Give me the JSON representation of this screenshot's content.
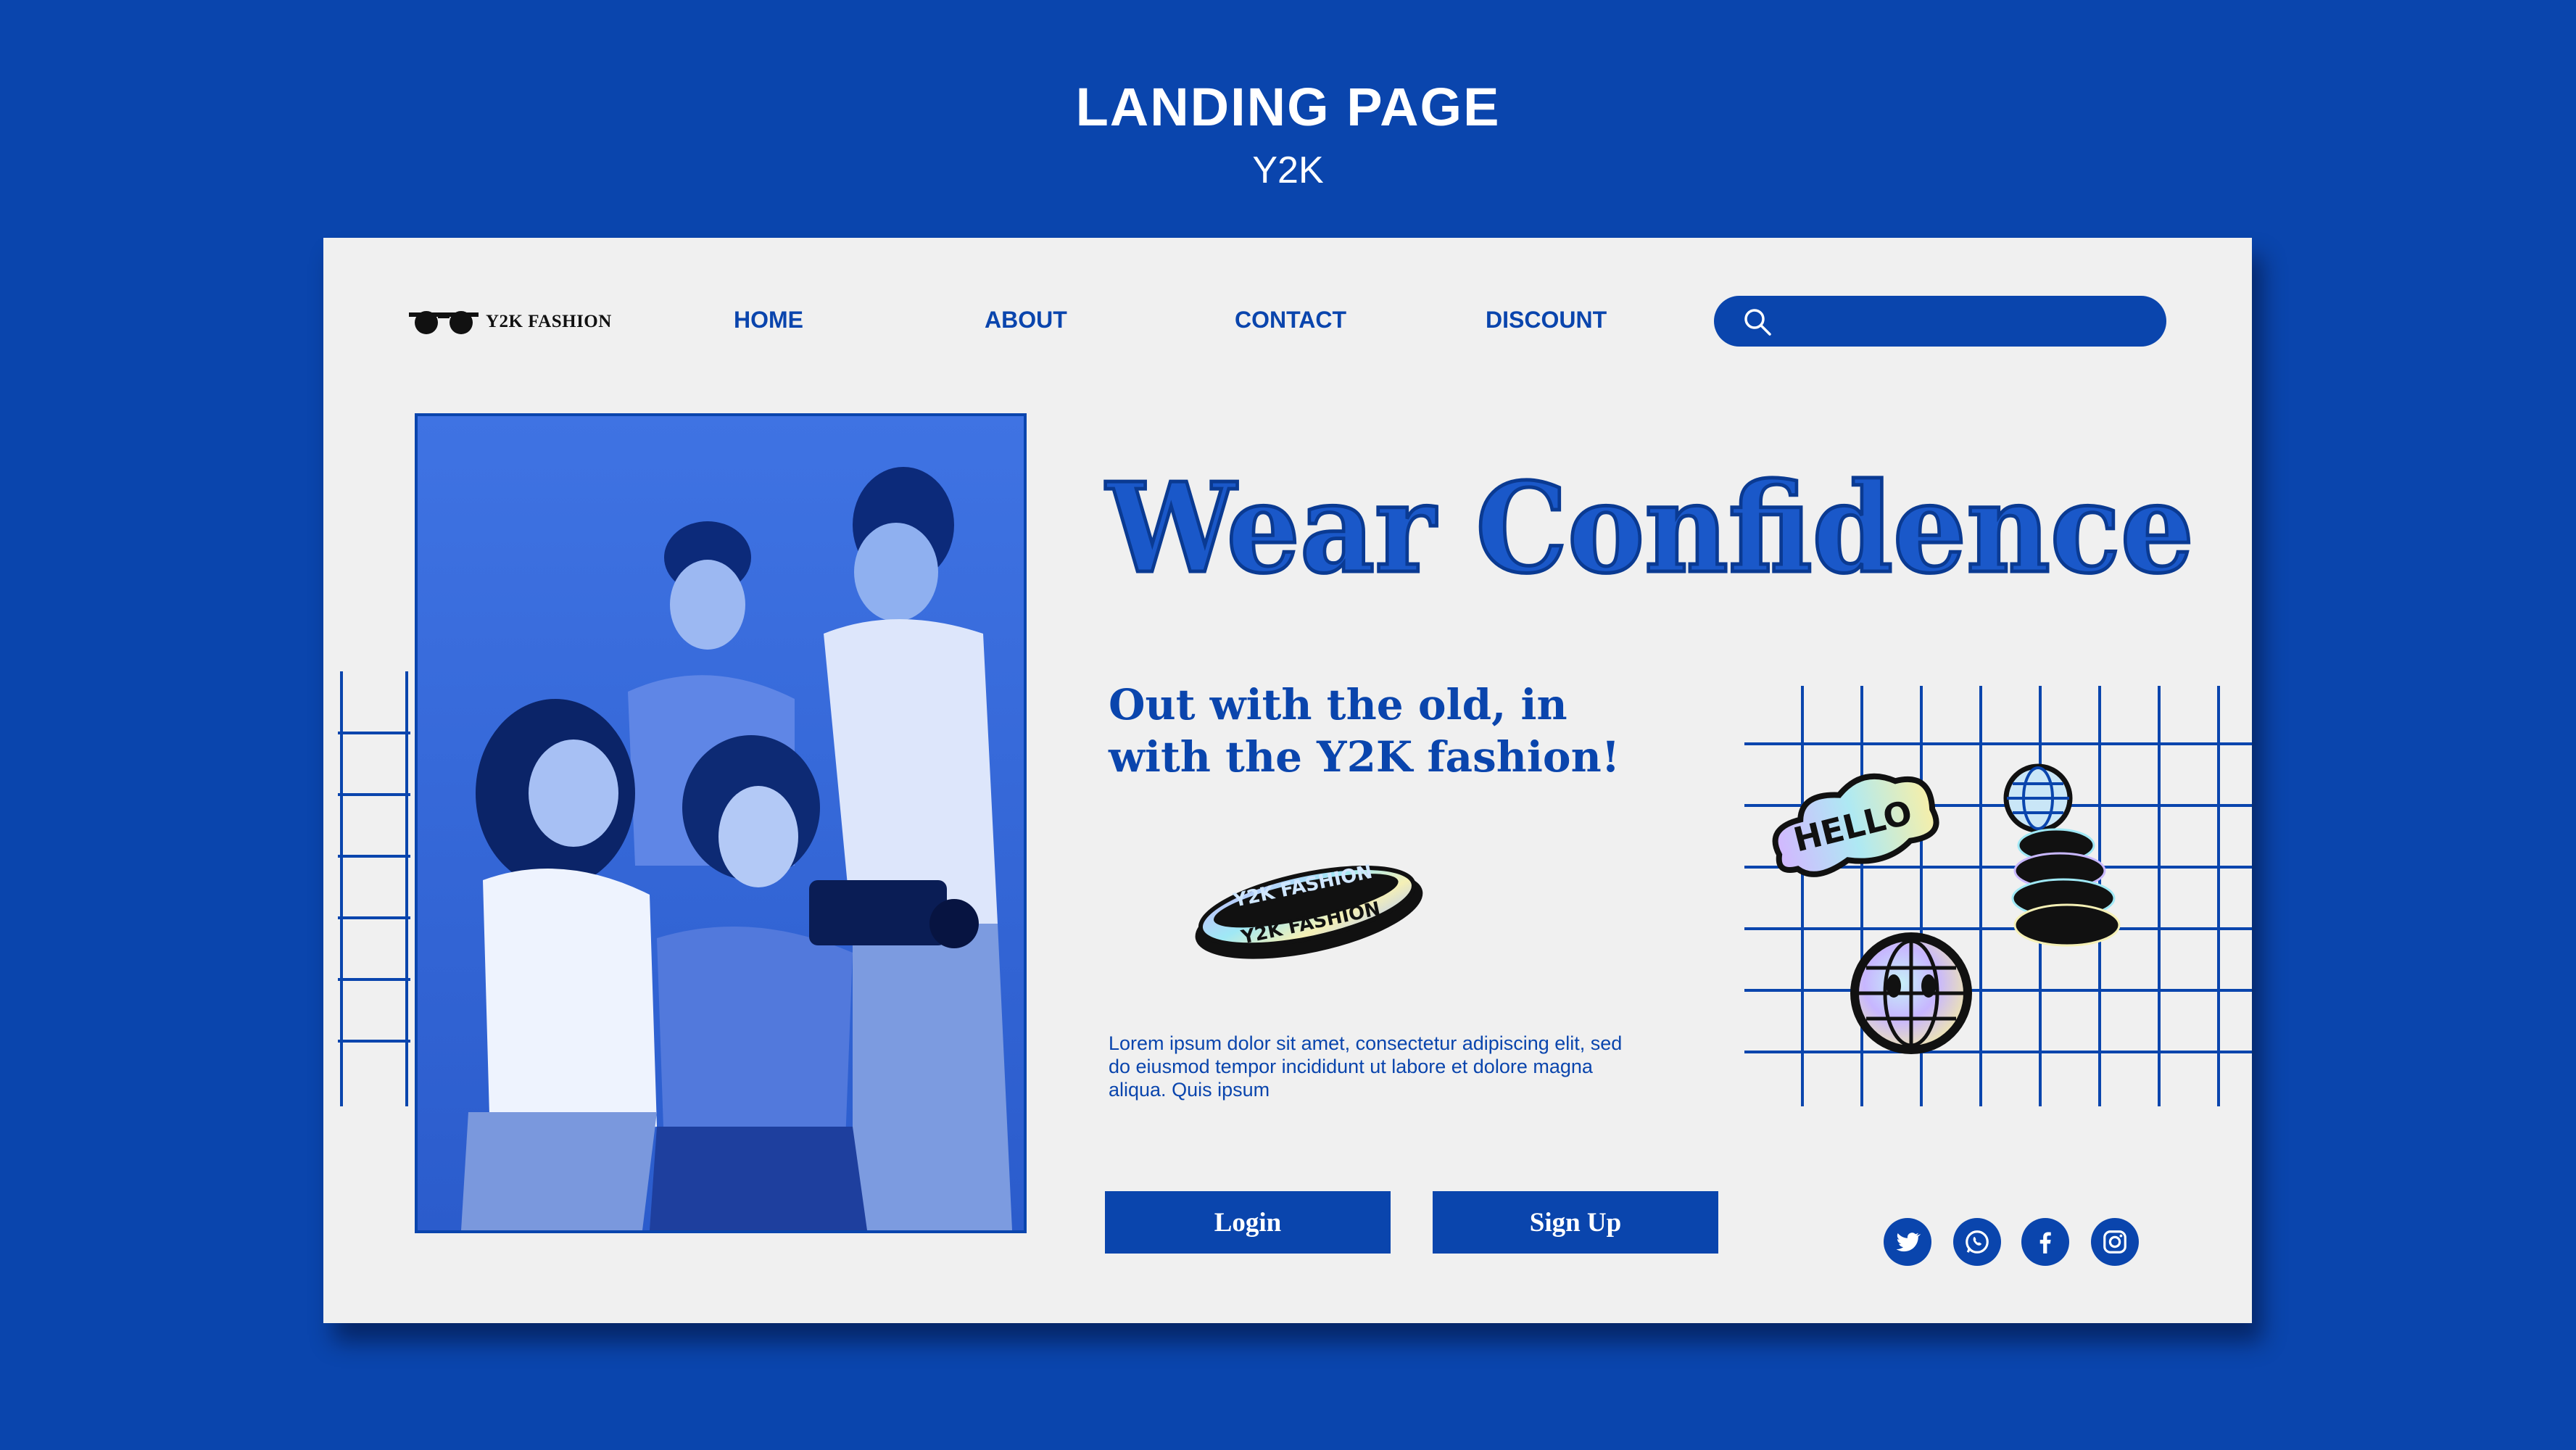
{
  "header": {
    "title": "LANDING PAGE",
    "subtitle": "Y2K"
  },
  "brand": {
    "name": "Y2K FASHION",
    "logo_icon": "sunglasses-icon"
  },
  "nav": {
    "items": [
      {
        "label": "HOME"
      },
      {
        "label": "ABOUT"
      },
      {
        "label": "CONTACT"
      },
      {
        "label": "DISCOUNT"
      }
    ]
  },
  "search": {
    "value": "",
    "icon": "search-icon"
  },
  "hero": {
    "headline": "Wear Confidence",
    "tagline": "Out with the old, in\nwith the Y2K fashion!",
    "body": "Lorem ipsum dolor sit amet, consectetur adipiscing elit, sed do eiusmod tempor incididunt ut labore et dolore magna aliqua. Quis ipsum"
  },
  "stickers": {
    "band_text": "Y2K FASHION",
    "hello_text": "HELLO"
  },
  "buttons": {
    "login": "Login",
    "signup": "Sign Up"
  },
  "social": [
    "twitter-icon",
    "whatsapp-icon",
    "facebook-icon",
    "instagram-icon"
  ],
  "colors": {
    "brand_blue": "#0a45ad",
    "panel": "#f0f0f0"
  }
}
